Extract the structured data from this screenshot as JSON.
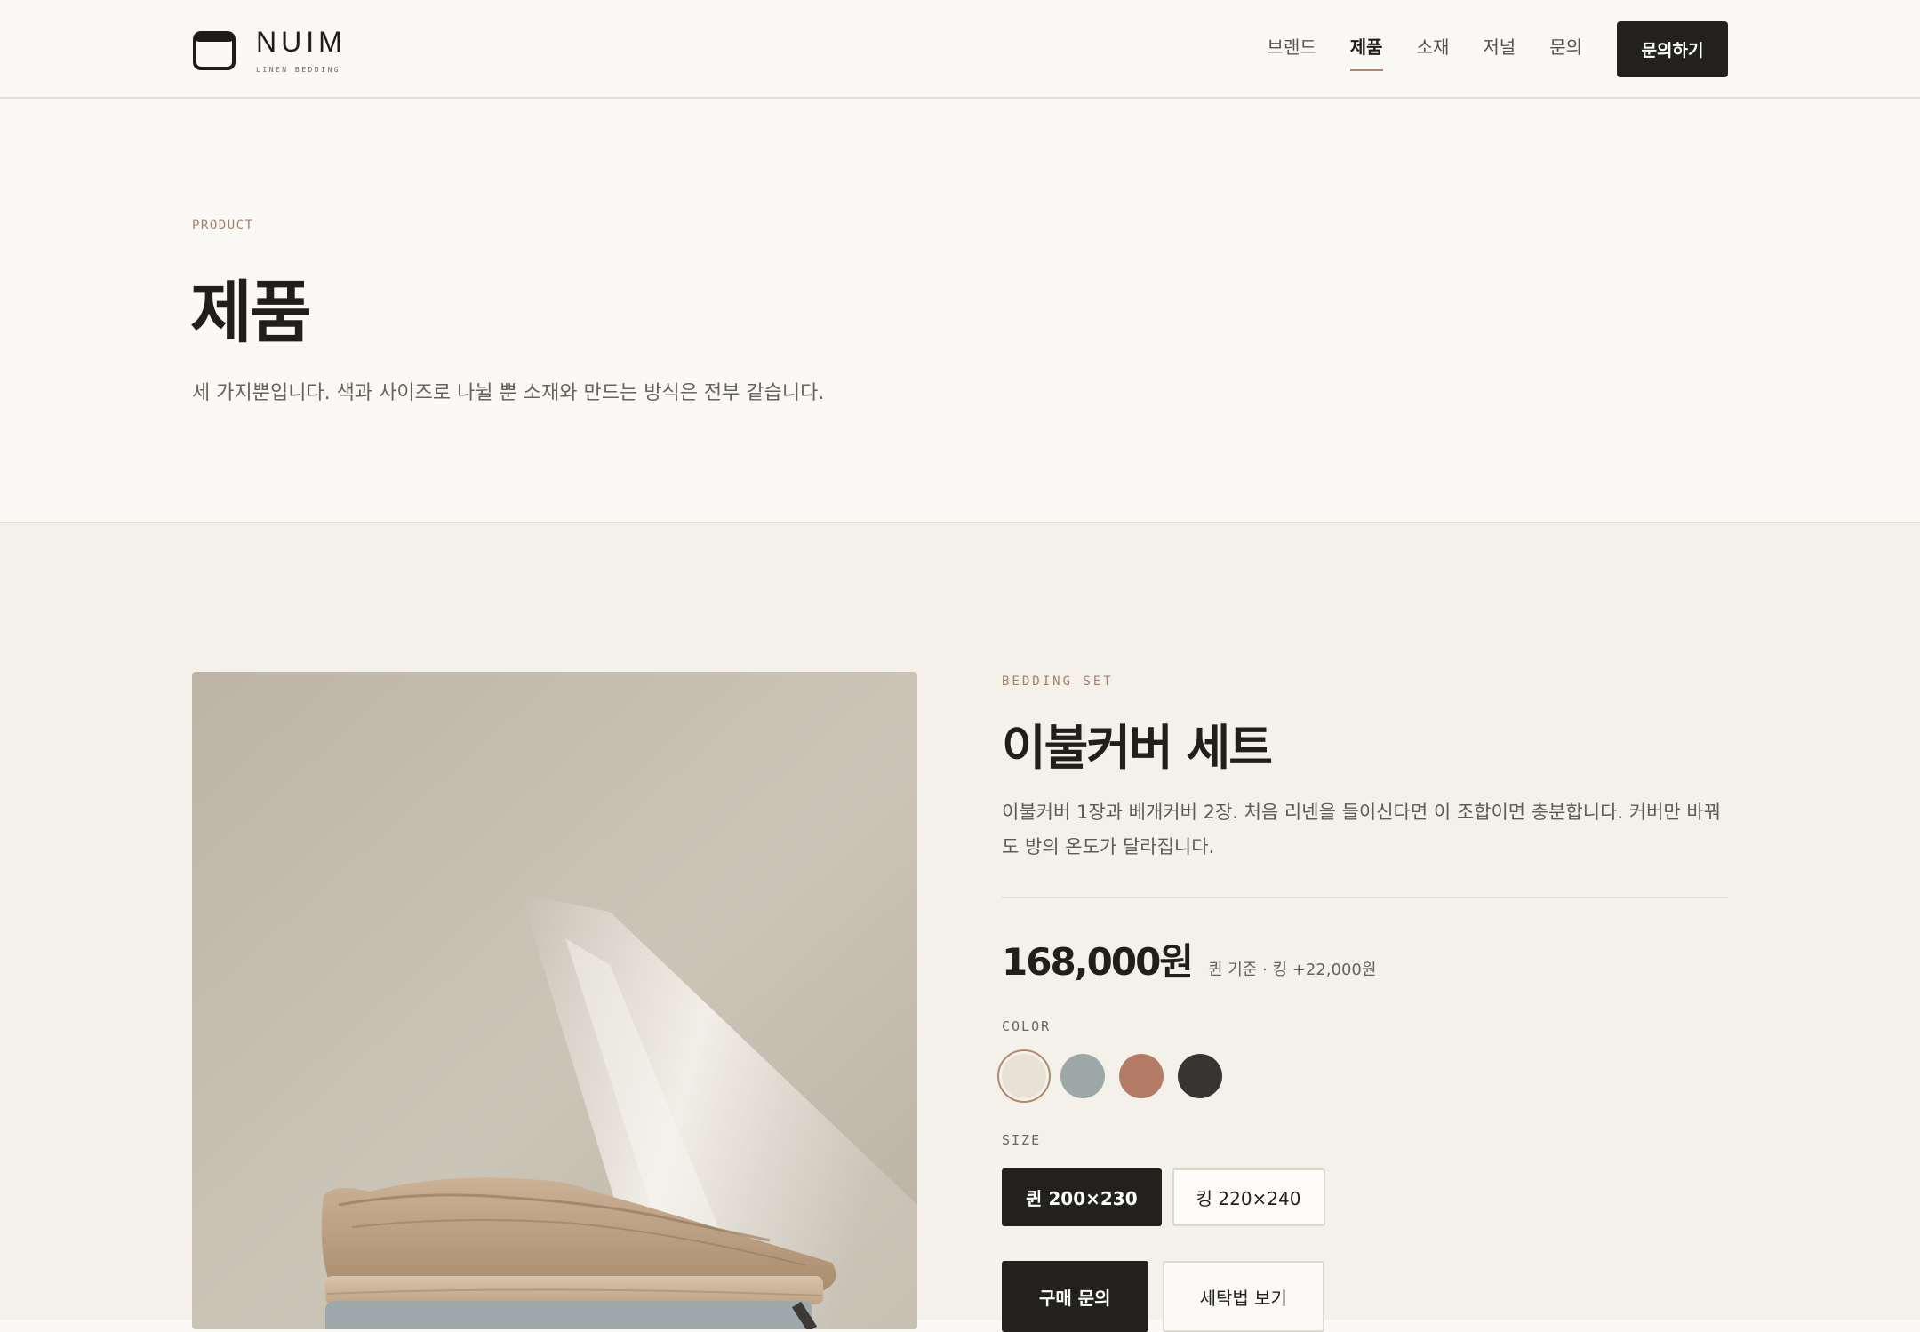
{
  "brand": {
    "name": "NUIM",
    "tagline": "LINEN BEDDING"
  },
  "nav": {
    "items": [
      {
        "label": "브랜드",
        "active": false
      },
      {
        "label": "제품",
        "active": true
      },
      {
        "label": "소재",
        "active": false
      },
      {
        "label": "저널",
        "active": false
      },
      {
        "label": "문의",
        "active": false
      }
    ],
    "cta_label": "문의하기"
  },
  "hero": {
    "eyebrow": "PRODUCT",
    "title": "제품",
    "description": "세 가지뿐입니다. 색과 사이즈로 나뉠 뿐 소재와 만드는 방식은 전부 같습니다."
  },
  "product": {
    "eyebrow": "BEDDING SET",
    "title": "이불커버 세트",
    "description": "이불커버 1장과 베개커버 2장. 처음 리넨을 들이신다면 이 조합이면 충분합니다. 커버만 바꿔도 방의 온도가 달라집니다.",
    "price": "168,000원",
    "price_note": "퀸 기준 · 킹 +22,000원",
    "color_label": "COLOR",
    "colors": [
      {
        "name": "natural",
        "hex": "#e8e1d5",
        "selected": true
      },
      {
        "name": "blue-grey",
        "hex": "#9ea7a8",
        "selected": false
      },
      {
        "name": "terracotta",
        "hex": "#b47c67",
        "selected": false
      },
      {
        "name": "charcoal",
        "hex": "#363532",
        "selected": false
      }
    ],
    "size_label": "SIZE",
    "sizes": [
      {
        "label": "퀸 200×230",
        "selected": true
      },
      {
        "label": "킹 220×240",
        "selected": false
      }
    ],
    "actions": {
      "primary": "구매 문의",
      "secondary": "세탁법 보기"
    }
  },
  "colors": {
    "accent": "#b5876b",
    "dark": "#23211d",
    "background": "#faf9f5",
    "section_bg": "#f4f1eb"
  }
}
